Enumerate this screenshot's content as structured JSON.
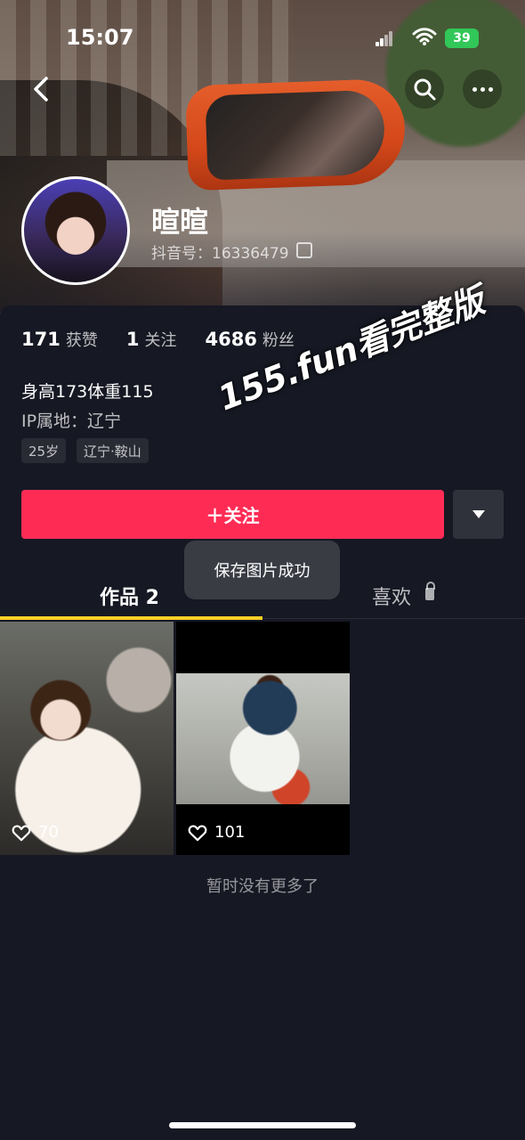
{
  "status_bar": {
    "time": "15:07",
    "battery": "39",
    "icons": [
      "signal-icon",
      "wifi-icon",
      "battery-icon"
    ]
  },
  "top_nav": {
    "icons": [
      "back-icon",
      "search-icon",
      "more-icon"
    ]
  },
  "profile": {
    "name": "暄暄",
    "douyin_id": "抖音号：16336479"
  },
  "stats": {
    "likes": {
      "value": "171",
      "label": "获赞"
    },
    "following": {
      "value": "1",
      "label": "关注"
    },
    "followers": {
      "value": "4686",
      "label": "粉丝"
    }
  },
  "bio": {
    "text": "身高173体重115",
    "ip": "IP属地：辽宁",
    "tags": [
      "25岁",
      "辽宁·鞍山"
    ]
  },
  "actions": {
    "follow_label": "＋关注"
  },
  "watermark": "155.fun看完整版",
  "toast": "保存图片成功",
  "tabs": {
    "works": "作品 2",
    "likes": "喜欢"
  },
  "grid": [
    {
      "likes": "70"
    },
    {
      "likes": "101"
    }
  ],
  "footer": {
    "no_more": "暂时没有更多了"
  },
  "colors": {
    "follow": "#fe2c55",
    "tab_active": "#facf25",
    "background": "#161823"
  }
}
